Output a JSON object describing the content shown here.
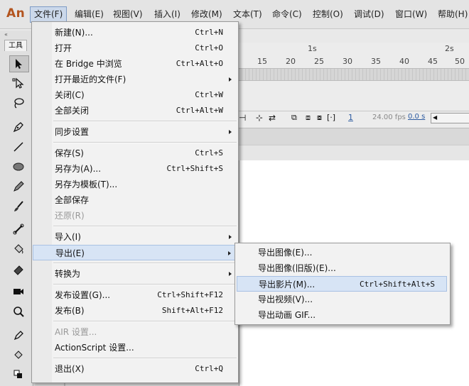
{
  "app": {
    "logo": "An"
  },
  "menubar": {
    "items": [
      {
        "label": "文件(F)",
        "active": true
      },
      {
        "label": "编辑(E)"
      },
      {
        "label": "视图(V)"
      },
      {
        "label": "插入(I)"
      },
      {
        "label": "修改(M)"
      },
      {
        "label": "文本(T)"
      },
      {
        "label": "命令(C)"
      },
      {
        "label": "控制(O)"
      },
      {
        "label": "调试(D)"
      },
      {
        "label": "窗口(W)"
      },
      {
        "label": "帮助(H)"
      }
    ]
  },
  "toolbox": {
    "collapse": "«",
    "tab_label": "工具"
  },
  "timeline": {
    "second_marks": [
      "1s",
      "2s"
    ],
    "frame_numbers": [
      "15",
      "20",
      "25",
      "30",
      "35",
      "40",
      "45",
      "50"
    ],
    "current_frame": "1",
    "fps": "24.00 fps",
    "time": "0.0 s"
  },
  "file_menu": {
    "items": [
      {
        "label": "新建(N)...",
        "shortcut": "Ctrl+N"
      },
      {
        "label": "打开",
        "shortcut": "Ctrl+O"
      },
      {
        "label": "在 Bridge 中浏览",
        "shortcut": "Ctrl+Alt+O"
      },
      {
        "label": "打开最近的文件(F)",
        "shortcut": "",
        "submenu": true
      },
      {
        "label": "关闭(C)",
        "shortcut": "Ctrl+W"
      },
      {
        "label": "全部关闭",
        "shortcut": "Ctrl+Alt+W"
      },
      {
        "label": "同步设置",
        "shortcut": "",
        "submenu": true
      },
      {
        "label": "保存(S)",
        "shortcut": "Ctrl+S"
      },
      {
        "label": "另存为(A)...",
        "shortcut": "Ctrl+Shift+S"
      },
      {
        "label": "另存为模板(T)...",
        "shortcut": ""
      },
      {
        "label": "全部保存",
        "shortcut": ""
      },
      {
        "label": "还原(R)",
        "shortcut": "",
        "disabled": true
      },
      {
        "label": "导入(I)",
        "shortcut": "",
        "submenu": true
      },
      {
        "label": "导出(E)",
        "shortcut": "",
        "submenu": true,
        "highlighted": true
      },
      {
        "label": "转换为",
        "shortcut": "",
        "submenu": true
      },
      {
        "label": "发布设置(G)...",
        "shortcut": "Ctrl+Shift+F12"
      },
      {
        "label": "发布(B)",
        "shortcut": "Shift+Alt+F12"
      },
      {
        "label": "AIR 设置...",
        "shortcut": "",
        "disabled": true
      },
      {
        "label": "ActionScript 设置...",
        "shortcut": ""
      },
      {
        "label": "退出(X)",
        "shortcut": "Ctrl+Q"
      }
    ]
  },
  "export_submenu": {
    "items": [
      {
        "label": "导出图像(E)...",
        "shortcut": ""
      },
      {
        "label": "导出图像(旧版)(E)...",
        "shortcut": ""
      },
      {
        "label": "导出影片(M)...",
        "shortcut": "Ctrl+Shift+Alt+S",
        "highlighted": true
      },
      {
        "label": "导出视频(V)...",
        "shortcut": ""
      },
      {
        "label": "导出动画 GIF...",
        "shortcut": ""
      }
    ]
  },
  "colors": {
    "logo": "#b3541e",
    "highlight": "#d7e4f5",
    "fps_text": "#2c5aa0"
  }
}
